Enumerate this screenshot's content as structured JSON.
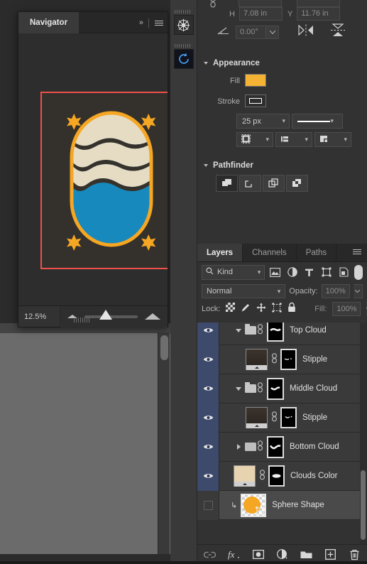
{
  "navigator": {
    "tab_label": "Navigator",
    "collapse_icon": "chevron-double-right-icon",
    "menu_icon": "hamburger-menu-icon",
    "zoom_level": "12.5%",
    "zoom_out_icon": "small-mountain-icon",
    "zoom_in_icon": "large-mountain-icon",
    "artwork": {
      "description": "orange outlined oval with blue fill, cream clouds at top, four orange stars",
      "background_color": "#34302c",
      "view_box_color": "#f0514a",
      "outline_color": "#f5a623",
      "body_color": "#1789bd",
      "cloud_color": "#e6dcc4",
      "cloud_shadow_color": "#36312b",
      "star_color": "#f5a623"
    }
  },
  "icon_dock": {
    "items": [
      {
        "name": "ship-wheel-icon",
        "active": false
      },
      {
        "name": "blue-circular-arrow-icon",
        "active": true
      }
    ]
  },
  "transform": {
    "link_icon": "link-chain-icon",
    "h_label": "H",
    "h_value": "7.08 in",
    "y_label": "Y",
    "y_value": "11.76 in",
    "angle_icon": "shear-angle-icon",
    "angle_value": "0.00°",
    "flip_horizontal_icon": "flip-horizontal-icon",
    "flip_vertical_icon": "flip-vertical-icon"
  },
  "appearance": {
    "title": "Appearance",
    "fill_label": "Fill",
    "fill_color": "#f5b335",
    "stroke_label": "Stroke",
    "stroke_color": "#ffffff",
    "stroke_width": "25 px",
    "stroke_style": "solid-line",
    "align_icon": "stroke-align-icon",
    "caps_icon": "stroke-caps-icon",
    "corner_icon": "stroke-corner-icon"
  },
  "pathfinder": {
    "title": "Pathfinder",
    "buttons": [
      {
        "name": "unite-icon",
        "selected": true
      },
      {
        "name": "subtract-front-icon",
        "selected": false
      },
      {
        "name": "intersect-icon",
        "selected": false
      },
      {
        "name": "exclude-overlap-icon",
        "selected": false
      }
    ]
  },
  "layers_panel": {
    "tabs": [
      {
        "label": "Layers",
        "active": true
      },
      {
        "label": "Channels",
        "active": false
      },
      {
        "label": "Paths",
        "active": false
      }
    ],
    "menu_icon": "hamburger-menu-icon",
    "filter": {
      "search_icon": "search-icon",
      "kind_label": "Kind",
      "icons": [
        "pixel-layer-filter-icon",
        "adjustment-layer-filter-icon",
        "type-layer-filter-icon",
        "shape-layer-filter-icon",
        "smart-object-filter-icon"
      ],
      "toggle_name": "filter-enable-toggle"
    },
    "blend_mode": "Normal",
    "opacity_label": "Opacity:",
    "opacity_value": "100%",
    "lock_label": "Lock:",
    "lock_icons": [
      "lock-transparent-pixels-icon",
      "lock-image-pixels-icon",
      "lock-position-icon",
      "lock-artboard-nesting-icon",
      "lock-all-icon"
    ],
    "fill_label": "Fill:",
    "fill_value": "100%",
    "layers": [
      {
        "name": "",
        "type": "partial-row",
        "visible": true,
        "selected": false,
        "partial": true,
        "indent": 1,
        "thumb": "text-thumb"
      },
      {
        "name": "Top Cloud",
        "type": "group",
        "visible": true,
        "selected": false,
        "expanded": true,
        "indent": 0,
        "linked": true,
        "mask": "black-mask-with-white-stroke"
      },
      {
        "name": "Stipple",
        "type": "layer",
        "visible": true,
        "selected": false,
        "indent": 1,
        "linked": true,
        "thumb": "dark-gradient-thumb",
        "mask": "black-mask-with-white-marks"
      },
      {
        "name": "Middle Cloud",
        "type": "group",
        "visible": true,
        "selected": false,
        "expanded": true,
        "indent": 0,
        "linked": true,
        "mask": "black-mask-with-white-stroke"
      },
      {
        "name": "Stipple",
        "type": "layer",
        "visible": true,
        "selected": false,
        "indent": 1,
        "linked": true,
        "thumb": "dark-gradient-thumb",
        "mask": "black-mask-with-white-marks"
      },
      {
        "name": "Bottom Cloud",
        "type": "group",
        "visible": true,
        "selected": false,
        "expanded": false,
        "indent": 0,
        "linked": true,
        "mask": "black-mask-with-white-stroke"
      },
      {
        "name": "Clouds Color",
        "type": "layer",
        "visible": true,
        "selected": false,
        "indent": 1,
        "linked": true,
        "thumb": "beige-solid-thumb",
        "thumb_color": "#e8d3b0",
        "mask": "black-mask-with-white-blob"
      },
      {
        "name": "Sphere Shape",
        "type": "shape",
        "visible": false,
        "selected": true,
        "indent": 1,
        "clipped": true,
        "thumb": "orange-circle-shape-thumb",
        "thumb_color": "#f5a623"
      }
    ],
    "bottom_buttons": [
      "link-layers-icon",
      "layer-style-fx-icon",
      "add-layer-mask-icon",
      "new-adjustment-layer-icon",
      "new-group-icon",
      "new-layer-icon",
      "delete-layer-icon"
    ]
  }
}
